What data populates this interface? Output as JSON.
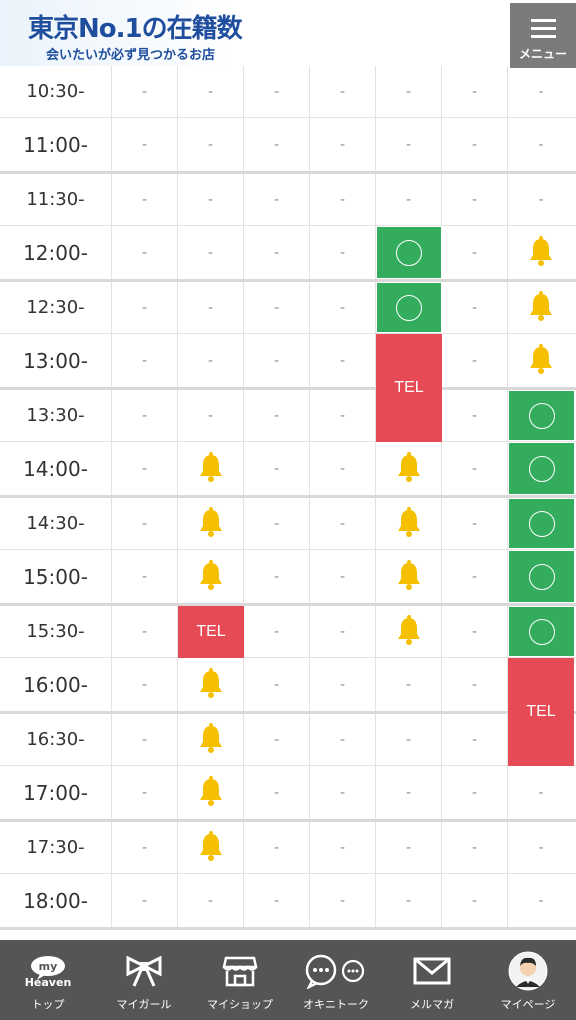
{
  "header": {
    "logo_title": "東京No.1の在籍数",
    "logo_subtitle": "会いたいが必ず見つかるお店",
    "menu_label": "メニュー"
  },
  "schedule": {
    "rows": [
      {
        "time": "10:30-",
        "cells": [
          "-",
          "-",
          "-",
          "-",
          "-",
          "-",
          "-"
        ]
      },
      {
        "time": "11:00-",
        "cells": [
          "-",
          "-",
          "-",
          "-",
          "-",
          "-",
          "-"
        ]
      },
      {
        "time": "11:30-",
        "cells": [
          "-",
          "-",
          "-",
          "-",
          "-",
          "-",
          "-"
        ]
      },
      {
        "time": "12:00-",
        "cells": [
          "-",
          "-",
          "-",
          "-",
          "○",
          "-",
          "bell"
        ]
      },
      {
        "time": "12:30-",
        "cells": [
          "-",
          "-",
          "-",
          "-",
          "○",
          "-",
          "bell"
        ]
      },
      {
        "time": "13:00-",
        "cells": [
          "-",
          "-",
          "-",
          "-",
          "TEL",
          "-",
          "bell"
        ]
      },
      {
        "time": "13:30-",
        "cells": [
          "-",
          "-",
          "-",
          "-",
          "TEL",
          "-",
          "○"
        ]
      },
      {
        "time": "14:00-",
        "cells": [
          "-",
          "bell",
          "-",
          "-",
          "bell",
          "-",
          "○"
        ]
      },
      {
        "time": "14:30-",
        "cells": [
          "-",
          "bell",
          "-",
          "-",
          "bell",
          "-",
          "○"
        ]
      },
      {
        "time": "15:00-",
        "cells": [
          "-",
          "bell",
          "-",
          "-",
          "bell",
          "-",
          "○"
        ]
      },
      {
        "time": "15:30-",
        "cells": [
          "-",
          "TEL",
          "-",
          "-",
          "bell",
          "-",
          "○"
        ]
      },
      {
        "time": "16:00-",
        "cells": [
          "-",
          "bell",
          "-",
          "-",
          "-",
          "-",
          "TEL"
        ]
      },
      {
        "time": "16:30-",
        "cells": [
          "-",
          "bell",
          "-",
          "-",
          "-",
          "-",
          "TEL"
        ]
      },
      {
        "time": "17:00-",
        "cells": [
          "-",
          "bell",
          "-",
          "-",
          "-",
          "-",
          "-"
        ]
      },
      {
        "time": "17:30-",
        "cells": [
          "-",
          "bell",
          "-",
          "-",
          "-",
          "-",
          "-"
        ]
      },
      {
        "time": "18:00-",
        "cells": [
          "-",
          "-",
          "-",
          "-",
          "-",
          "-",
          "-"
        ]
      }
    ],
    "tel_label": "TEL",
    "colors": {
      "available": "#34ac5e",
      "tel": "#e64b55",
      "bell": "#f5c000"
    }
  },
  "tabbar": {
    "items": [
      {
        "label": "トップ",
        "icon": "my-heaven-icon",
        "icon_text_top": "my",
        "icon_text_bottom": "Heaven"
      },
      {
        "label": "マイガール",
        "icon": "ribbon-icon"
      },
      {
        "label": "マイショップ",
        "icon": "shop-icon"
      },
      {
        "label": "オキニトーク",
        "icon": "chat-bubbles-icon"
      },
      {
        "label": "メルマガ",
        "icon": "mail-icon"
      },
      {
        "label": "マイページ",
        "icon": "avatar-icon"
      }
    ]
  }
}
